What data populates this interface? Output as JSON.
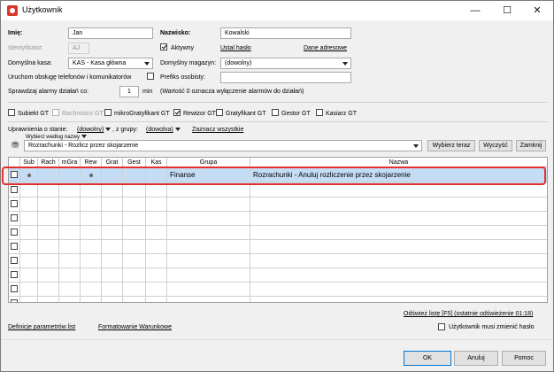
{
  "window": {
    "title": "Użytkownik",
    "minimize": "—",
    "maximize": "☐",
    "close": "✕"
  },
  "form": {
    "imie_label": "Imię:",
    "imie_value": "Jan",
    "nazwisko_label": "Nazwisko:",
    "nazwisko_value": "Kowalski",
    "identyfikator_label": "Identyfikator:",
    "identyfikator_value": "AJ",
    "aktywny_label": "Aktywny",
    "ustal_haslo": "Ustal hasło",
    "dane_adresowe": "Dane adresowe",
    "kasa_label": "Domyślna kasa:",
    "kasa_value": "KAS - Kasa główna",
    "magazyn_label": "Domyślny magazyn:",
    "magazyn_value": "(dowolny)",
    "telefony_label": "Uruchom obsługę telefonów i komunikatorów",
    "prefiks_label": "Prefiks osobisty:",
    "prefiks_value": "",
    "alarmy_label": "Sprawdzaj alarmy działań co:",
    "alarmy_value": "1",
    "alarmy_unit": "min",
    "alarmy_note": "(Wartość 0 oznacza wyłączenie alarmów do działań)"
  },
  "roles": [
    {
      "label": "Subiekt GT",
      "checked": false,
      "enabled": true
    },
    {
      "label": "Rachmistrz GT",
      "checked": false,
      "enabled": false
    },
    {
      "label": "mikroGratyfikant GT",
      "checked": false,
      "enabled": true
    },
    {
      "label": "Rewizor GT",
      "checked": true,
      "enabled": true
    },
    {
      "label": "Gratyfikant GT",
      "checked": false,
      "enabled": true
    },
    {
      "label": "Gestor GT",
      "checked": false,
      "enabled": true
    },
    {
      "label": "Kasiarz GT",
      "checked": false,
      "enabled": true
    }
  ],
  "filters": {
    "stan_label": "Uprawnienia o stanie:",
    "stan_value": "(dowolny)",
    "grupa_label": ", z grupy:",
    "grupa_value": "(dowolna)",
    "zaznacz": "Zaznacz wszystkie",
    "wybierz_nazwy": "Wybierz według nazwy",
    "search_value": "Rozrachunki - Rozlicz przez skojarzenie",
    "wybierz_teraz": "Wybierz teraz",
    "wyczysc": "Wyczyść",
    "zamknij": "Zamknij"
  },
  "grid": {
    "columns": [
      "Sub",
      "Rach",
      "mGra",
      "Rew",
      "Grat",
      "Gest",
      "Kas",
      "Grupa",
      "Nazwa"
    ],
    "rows": [
      {
        "grupa": "Finanse",
        "nazwa": "Rozrachunki - Anuluj rozliczenie przez skojarzenie",
        "sub": true,
        "rew": true
      }
    ]
  },
  "footer": {
    "odswiez": "Odśwież listę [F5] (ostatnie odświeżenie 01:18)",
    "definicje": "Definicje parametrów list",
    "formatowanie": "Formatowanie Warunkowe",
    "zmienic_haslo": "Użytkownik musi zmienić hasło",
    "ok": "OK",
    "anuluj": "Anuluj",
    "pomoc": "Pomoc"
  }
}
